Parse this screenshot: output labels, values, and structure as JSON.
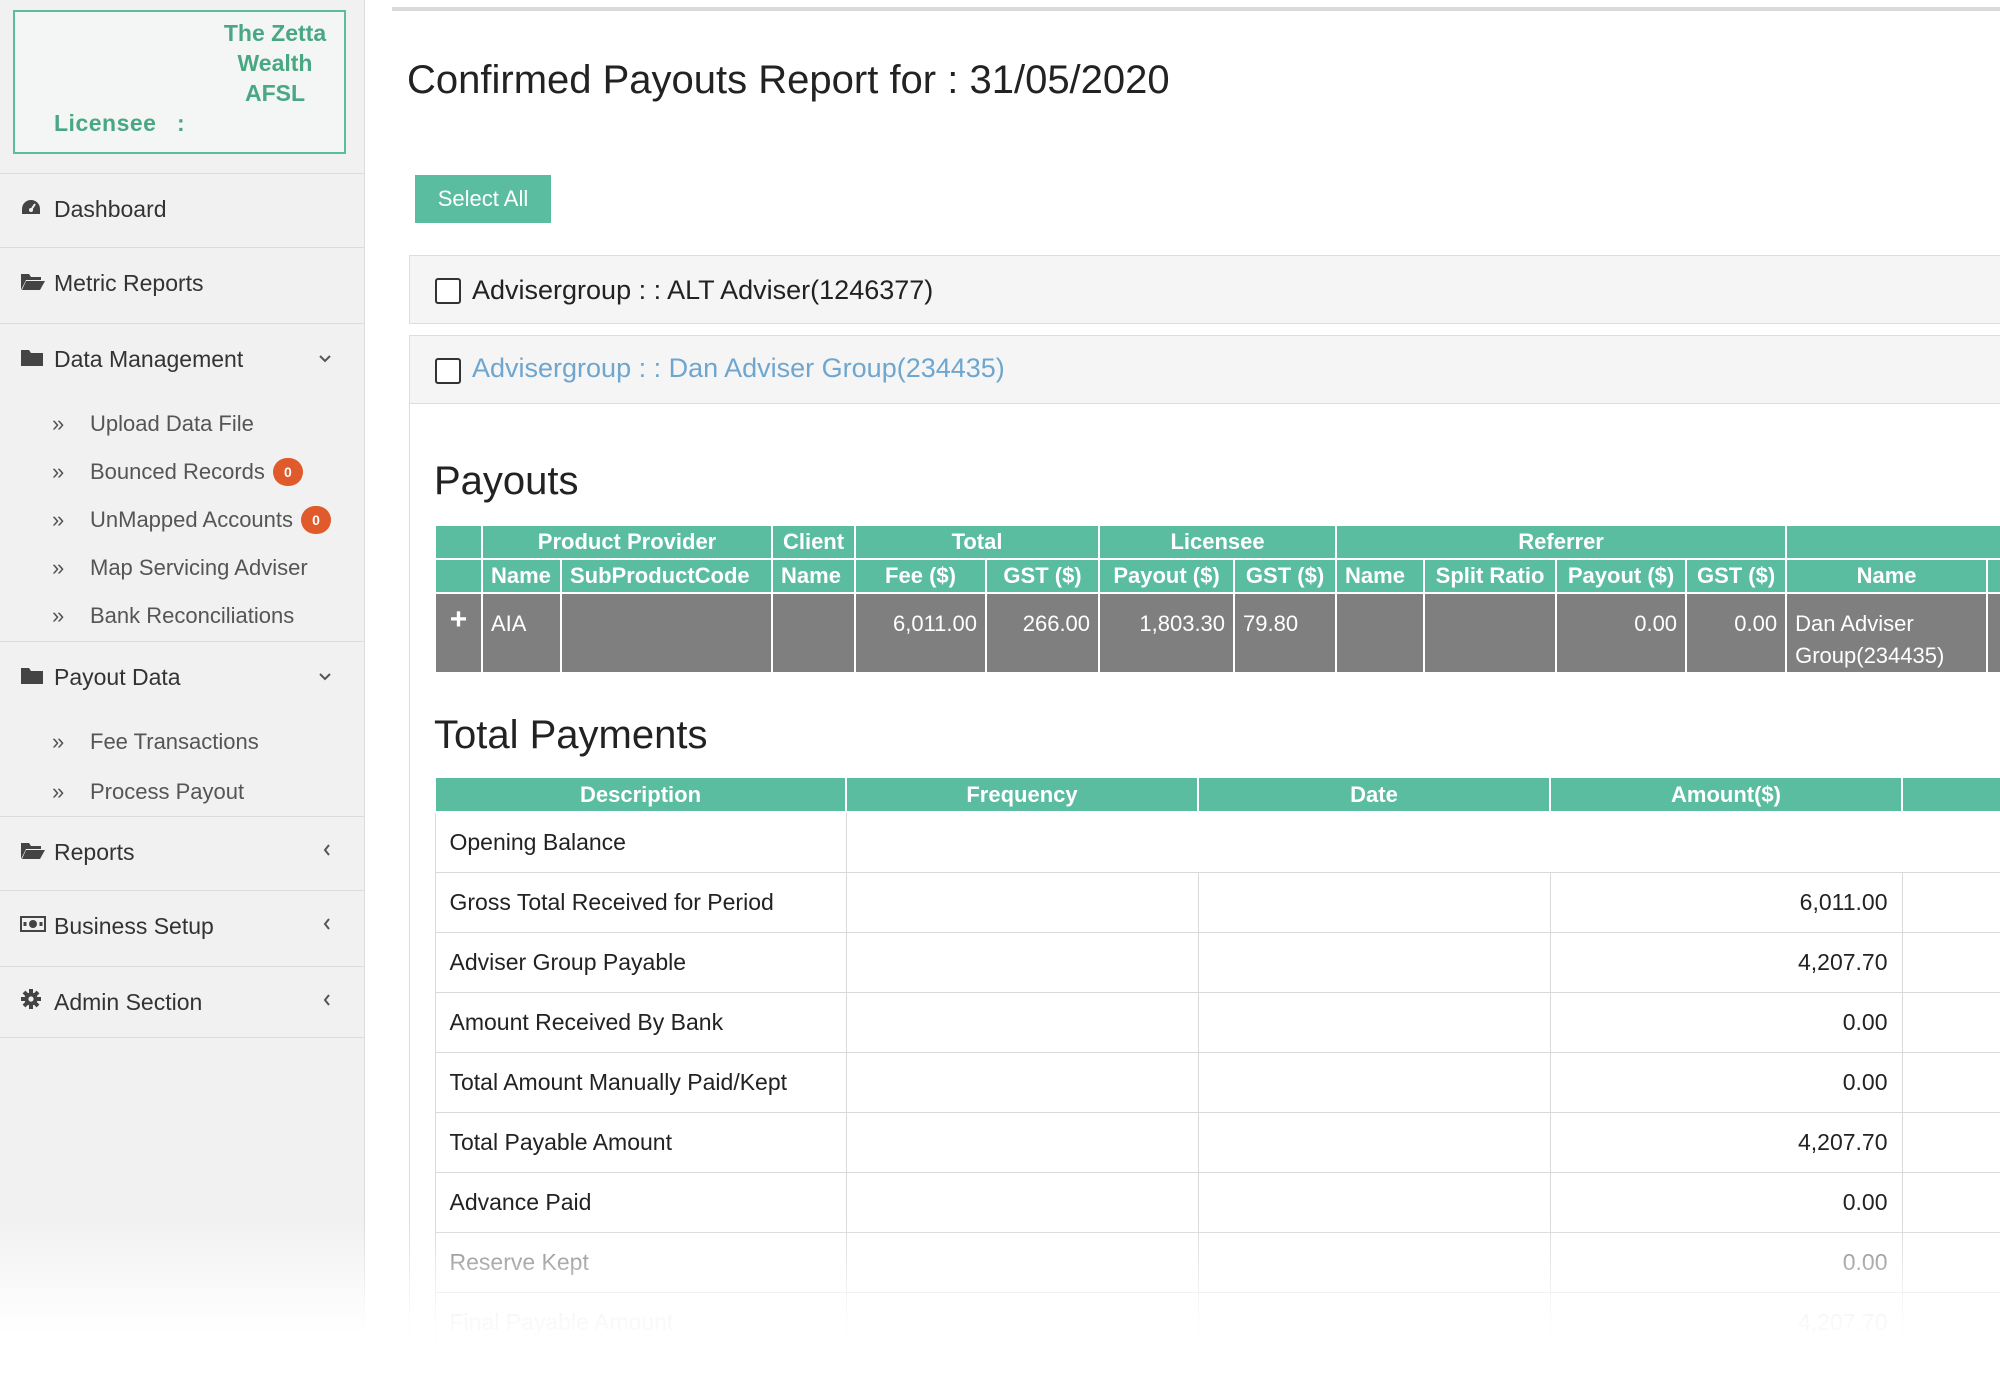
{
  "sidebar": {
    "licensee_label": "Licensee",
    "licensee_colon": ":",
    "licensee_name": "The Zetta Wealth AFSL",
    "menu": [
      {
        "label": "Dashboard",
        "icon": "dashboard-icon"
      },
      {
        "label": "Metric Reports",
        "icon": "folder-open-icon"
      },
      {
        "label": "Data Management",
        "icon": "folder-icon"
      },
      {
        "label": "Payout Data",
        "icon": "folder-icon"
      },
      {
        "label": "Reports",
        "icon": "folder-open-icon"
      },
      {
        "label": "Business Setup",
        "icon": "money-icon"
      },
      {
        "label": "Admin Section",
        "icon": "gear-icon"
      }
    ],
    "data_management_items": [
      {
        "label": "Upload Data File"
      },
      {
        "label": "Bounced Records",
        "badge": "0"
      },
      {
        "label": "UnMapped Accounts",
        "badge": "0"
      },
      {
        "label": "Map Servicing Adviser"
      },
      {
        "label": "Bank Reconciliations"
      }
    ],
    "payout_data_items": [
      {
        "label": "Fee Transactions"
      },
      {
        "label": "Process Payout"
      }
    ]
  },
  "main": {
    "title": "Confirmed Payouts Report for : 31/05/2020",
    "select_all_label": "Select All",
    "groups": [
      {
        "label": "Advisergroup : : ALT Adviser(1246377)",
        "checked": false
      },
      {
        "label": "Advisergroup : : Dan Adviser Group(234435)",
        "checked": false
      }
    ],
    "payouts": {
      "title": "Payouts",
      "header_groups": [
        "Product Provider",
        "Client",
        "Total",
        "Licensee",
        "Referrer"
      ],
      "columns": [
        "Name",
        "SubProductCode",
        "Name",
        "Fee ($)",
        "GST ($)",
        "Payout ($)",
        "GST ($)",
        "Name",
        "Split Ratio",
        "Payout ($)",
        "GST ($)",
        "Name"
      ],
      "rows": [
        {
          "expand": "+",
          "provider_name": "AIA",
          "sub_product_code": "",
          "client_name": "",
          "total_fee": "6,011.00",
          "total_gst": "266.00",
          "licensee_payout": "1,803.30",
          "licensee_gst": "79.80",
          "referrer_name": "",
          "referrer_split": "",
          "referrer_payout": "0.00",
          "referrer_gst": "0.00",
          "adviser_name": "Dan Adviser Group(234435)"
        }
      ]
    },
    "total_payments": {
      "title": "Total Payments",
      "columns": [
        "Description",
        "Frequency",
        "Date",
        "Amount($)"
      ],
      "rows": [
        {
          "description": "Opening Balance",
          "frequency": "",
          "date": "",
          "amount": ""
        },
        {
          "description": "Gross Total Received for Period",
          "frequency": "",
          "date": "",
          "amount": "6,011.00"
        },
        {
          "description": "Adviser Group Payable",
          "frequency": "",
          "date": "",
          "amount": "4,207.70"
        },
        {
          "description": "Amount Received By Bank",
          "frequency": "",
          "date": "",
          "amount": "0.00"
        },
        {
          "description": "Total Amount Manually Paid/Kept",
          "frequency": "",
          "date": "",
          "amount": "0.00"
        },
        {
          "description": "Total Payable Amount",
          "frequency": "",
          "date": "",
          "amount": "4,207.70"
        },
        {
          "description": "Advance Paid",
          "frequency": "",
          "date": "",
          "amount": "0.00"
        },
        {
          "description": "Reserve Kept",
          "frequency": "",
          "date": "",
          "amount": "0.00"
        },
        {
          "description": "Final Payable Amount",
          "frequency": "",
          "date": "",
          "amount": "4,207.70"
        }
      ]
    }
  },
  "colors": {
    "accent": "#5bbd9f",
    "row_grey": "#7f7f7f",
    "badge": "#e05a2b",
    "link_blue": "#6ea6cf"
  }
}
